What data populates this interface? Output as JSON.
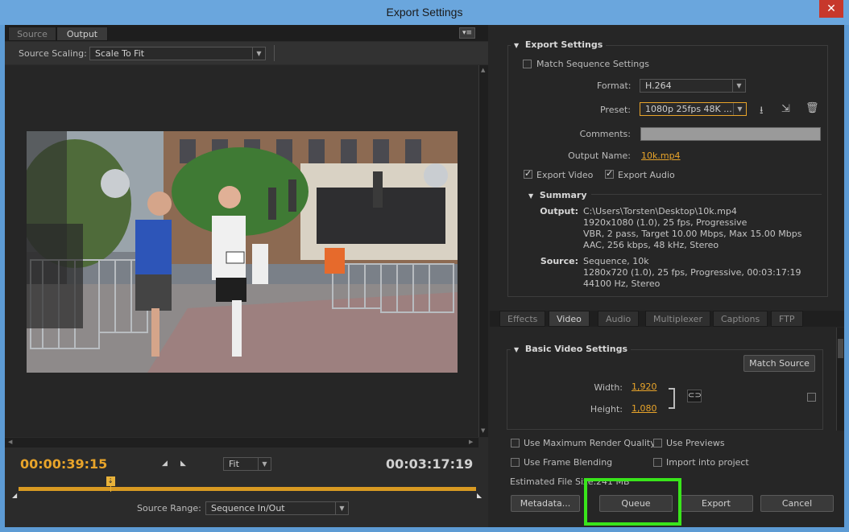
{
  "window": {
    "title": "Export Settings",
    "close_glyph": "✕"
  },
  "left": {
    "tabs": [
      "Source",
      "Output"
    ],
    "panel_menu_icon": "▾≡",
    "source_scaling_label": "Source Scaling:",
    "source_scaling_value": "Scale To Fit",
    "current_time": "00:00:39:15",
    "total_time": "00:03:17:19",
    "zoom_value": "Fit",
    "source_range_label": "Source Range:",
    "source_range_value": "Sequence In/Out",
    "playhead_progress": 0.2
  },
  "export_settings": {
    "header": "Export Settings",
    "match_sequence_label": "Match Sequence Settings",
    "format_label": "Format:",
    "format_value": "H.264",
    "preset_label": "Preset:",
    "preset_value": "1080p 25fps 48K ...",
    "comments_label": "Comments:",
    "output_name_label": "Output Name:",
    "output_name_value": "10k.mp4",
    "export_video_label": "Export Video",
    "export_audio_label": "Export Audio",
    "summary_header": "Summary",
    "output_label": "Output:",
    "output_lines": [
      "C:\\Users\\Torsten\\Desktop\\10k.mp4",
      "1920x1080 (1.0), 25 fps, Progressive",
      "VBR, 2 pass, Target 10.00 Mbps, Max 15.00 Mbps",
      "AAC, 256 kbps, 48 kHz, Stereo"
    ],
    "source_label": "Source:",
    "source_lines": [
      "Sequence, 10k",
      "1280x720 (1.0), 25 fps, Progressive, 00:03:17:19",
      "44100 Hz, Stereo"
    ]
  },
  "settings_tabs": [
    "Effects",
    "Video",
    "Audio",
    "Multiplexer",
    "Captions",
    "FTP"
  ],
  "video": {
    "header": "Basic Video Settings",
    "match_source_label": "Match Source",
    "width_label": "Width:",
    "width_value": "1,920",
    "height_label": "Height:",
    "height_value": "1,080"
  },
  "footer": {
    "max_render_quality": "Use Maximum Render Quality",
    "use_previews": "Use Previews",
    "frame_blending": "Use Frame Blending",
    "import_into_project": "Import into project",
    "estimated_size_label": "Estimated File Size:",
    "estimated_size_value": "241 MB",
    "metadata_btn": "Metadata...",
    "queue_btn": "Queue",
    "export_btn": "Export",
    "cancel_btn": "Cancel"
  },
  "colors": {
    "accent": "#e8a42a",
    "highlight": "#39e51b",
    "titlebar": "#6aa6dd"
  }
}
